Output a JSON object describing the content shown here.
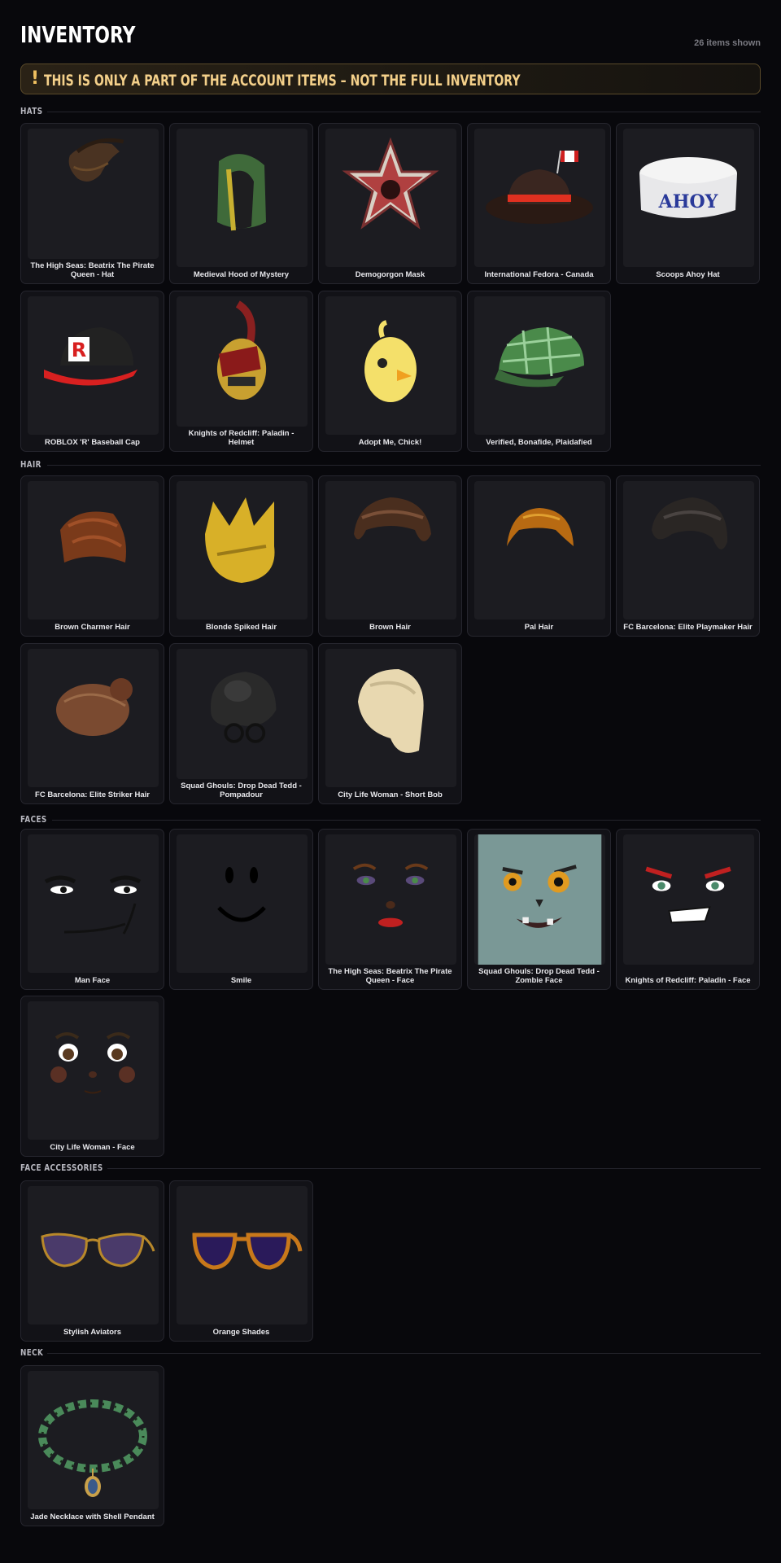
{
  "header": {
    "title": "INVENTORY",
    "count": "26 items shown"
  },
  "banner": {
    "icon": "!",
    "text": "THIS IS ONLY A PART OF THE ACCOUNT ITEMS – NOT THE FULL INVENTORY"
  },
  "sections": [
    {
      "label": "HATS",
      "items": [
        {
          "name": "The High Seas: Beatrix The Pirate Queen - Hat",
          "icon": "pirate-hat-icon"
        },
        {
          "name": "Medieval Hood of Mystery",
          "icon": "green-hood-icon"
        },
        {
          "name": "Demogorgon Mask",
          "icon": "demogorgon-mask-icon"
        },
        {
          "name": "International Fedora - Canada",
          "icon": "fedora-canada-icon"
        },
        {
          "name": "Scoops Ahoy Hat",
          "icon": "sailor-hat-icon"
        },
        {
          "name": "ROBLOX 'R' Baseball Cap",
          "icon": "baseball-cap-icon"
        },
        {
          "name": "Knights of Redcliff: Paladin - Helmet",
          "icon": "knight-helmet-icon"
        },
        {
          "name": "Adopt Me, Chick!",
          "icon": "chick-icon"
        },
        {
          "name": "Verified, Bonafide, Plaidafied",
          "icon": "plaid-cap-icon"
        }
      ]
    },
    {
      "label": "HAIR",
      "items": [
        {
          "name": "Brown Charmer Hair",
          "icon": "brown-hair-icon"
        },
        {
          "name": "Blonde Spiked Hair",
          "icon": "blonde-hair-icon"
        },
        {
          "name": "Brown Hair",
          "icon": "brown-hair-2-icon"
        },
        {
          "name": "Pal Hair",
          "icon": "pal-hair-icon"
        },
        {
          "name": "FC Barcelona: Elite Playmaker Hair",
          "icon": "dark-hair-icon"
        },
        {
          "name": "FC Barcelona: Elite Striker Hair",
          "icon": "bun-hair-icon"
        },
        {
          "name": "Squad Ghouls: Drop Dead Tedd - Pompadour",
          "icon": "pompadour-icon"
        },
        {
          "name": "City Life Woman - Short Bob",
          "icon": "blonde-bob-icon"
        }
      ]
    },
    {
      "label": "FACES",
      "items": [
        {
          "name": "Man Face",
          "icon": "man-face-icon"
        },
        {
          "name": "Smile",
          "icon": "smile-face-icon"
        },
        {
          "name": "The High Seas: Beatrix The Pirate Queen - Face",
          "icon": "pirate-face-icon"
        },
        {
          "name": "Squad Ghouls: Drop Dead Tedd - Zombie Face",
          "icon": "zombie-face-icon"
        },
        {
          "name": "Knights of Redcliff: Paladin - Face",
          "icon": "paladin-face-icon"
        },
        {
          "name": "City Life Woman - Face",
          "icon": "woman-face-icon"
        }
      ]
    },
    {
      "label": "FACE ACCESSORIES",
      "items": [
        {
          "name": "Stylish Aviators",
          "icon": "aviators-icon"
        },
        {
          "name": "Orange Shades",
          "icon": "orange-shades-icon"
        }
      ]
    },
    {
      "label": "NECK",
      "items": [
        {
          "name": "Jade Necklace with Shell Pendant",
          "icon": "jade-necklace-icon"
        }
      ]
    }
  ]
}
